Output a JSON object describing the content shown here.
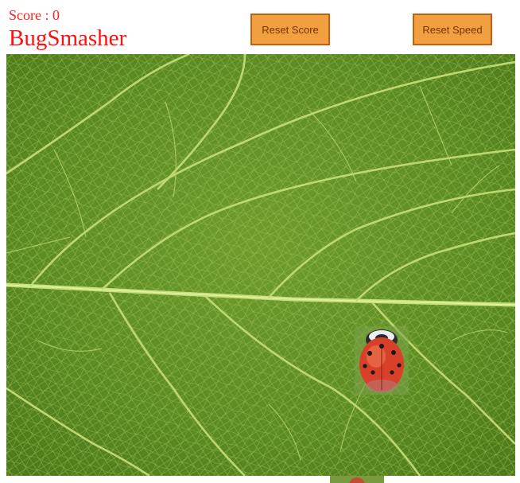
{
  "header": {
    "score_label": "Score : ",
    "score_value": "0",
    "title": "BugSmasher"
  },
  "toolbar": {
    "reset_score_label": "Reset Score",
    "reset_speed_label": "Reset Speed"
  },
  "game": {
    "bug_icon": "ladybug-icon",
    "background": "green-leaf-texture",
    "colors": {
      "title": "#ff1010",
      "button_fill": "#f0a040",
      "button_border": "#c06010",
      "leaf": "#5e8c23",
      "ladybug": "#d8402a"
    }
  }
}
